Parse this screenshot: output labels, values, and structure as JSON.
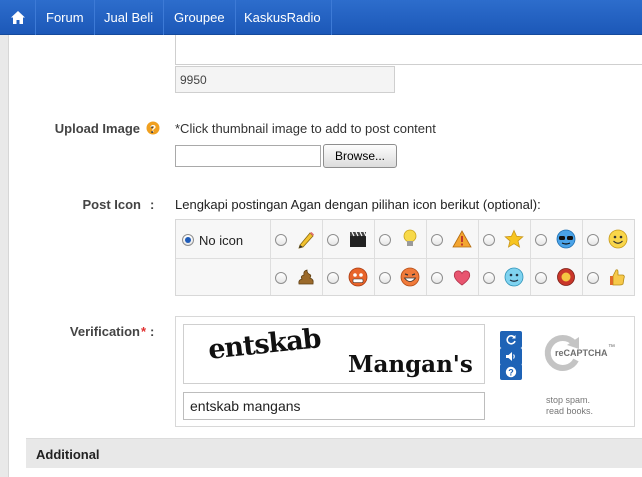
{
  "nav": {
    "home_icon": "home-icon",
    "items": [
      "Forum",
      "Jual Beli",
      "Groupee",
      "KaskusRadio"
    ]
  },
  "editor": {
    "char_count": "9950"
  },
  "upload": {
    "label": "Upload Image",
    "help_icon": "question-icon",
    "colon": ":",
    "hint": "*Click thumbnail image to add to post content",
    "browse_label": "Browse..."
  },
  "post_icon": {
    "label": "Post Icon",
    "colon": ":",
    "description": "Lengkapi postingan Agan dengan pilihan icon berikut (optional):",
    "no_icon_label": "No icon",
    "selected": "No icon",
    "icons_row1": [
      "pencil-icon",
      "clapperboard-icon",
      "lightbulb-icon",
      "warning-icon",
      "star-icon",
      "cool-face-icon",
      "smile-face-icon"
    ],
    "icons_row2": [
      "poop-icon",
      "angry-face-icon",
      "grin-face-icon",
      "heart-icon",
      "cold-face-icon",
      "flower-icon",
      "thumbs-up-icon"
    ]
  },
  "verification": {
    "label": "Verification",
    "required_mark": "*",
    "colon": ":",
    "captcha_word1": "entskab",
    "captcha_word2": "Mangan's",
    "input_value": "entskab mangans",
    "recaptcha_brand": "reCAPTCHA",
    "tm": "™",
    "tagline1": "stop spam.",
    "tagline2": "read books."
  },
  "additional": {
    "title": "Additional"
  },
  "colors": {
    "nav_bg": "#2563c4",
    "accent": "#1e63b6",
    "required": "#e03030",
    "help": "#f0a020"
  }
}
